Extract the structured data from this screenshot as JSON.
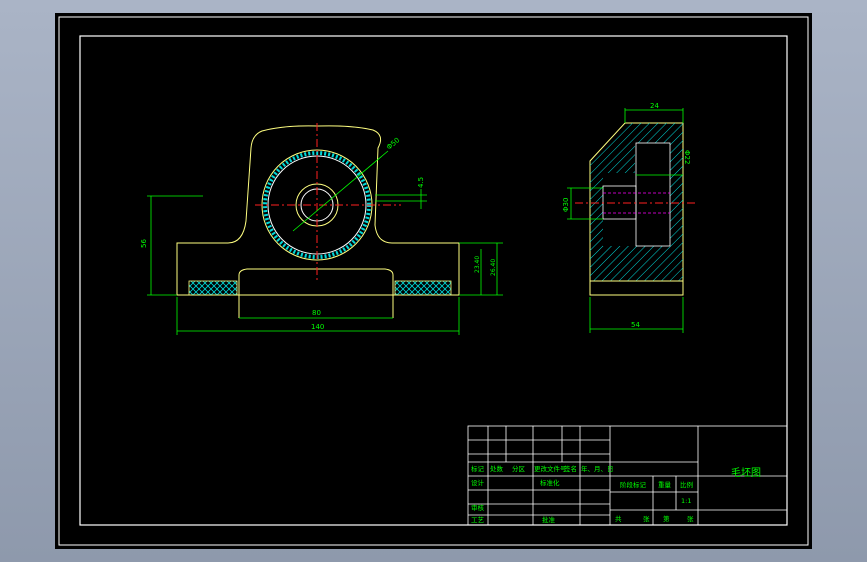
{
  "colors": {
    "background": "#000000",
    "frame": "#ffffff",
    "outline": "#ffff80",
    "dimension": "#00ff00",
    "centerline": "#ff2020",
    "hatch": "#00d8d8",
    "bore": "#ff00ff",
    "text": "#00ff00"
  },
  "front_view": {
    "dim_diameter": "Φ50",
    "dim_offset": "4.5",
    "dim_height": "56",
    "dim_base": "23.40",
    "dim_base_total": "26.40",
    "dim_pad_width": "80",
    "dim_total_width": "140"
  },
  "side_view": {
    "dim_top": "24",
    "dim_bore_outer": "Φ30",
    "dim_bore_inner": "Φ22",
    "dim_bottom": "54"
  },
  "title_block": {
    "drawing_title": "毛坯图",
    "row_header": [
      "标记",
      "处数",
      "分区",
      "更改文件号",
      "签名",
      "年、月、日"
    ],
    "design_label": "设计",
    "standardize_label": "标准化",
    "review_label": "审核",
    "process_label": "工艺",
    "approve_label": "批准",
    "stage_mark_label": "阶段标记",
    "weight_label": "重量",
    "scale_label": "比例",
    "scale_value": "1:1",
    "sheet_total_label": "共",
    "sheet_unit1": "张",
    "sheet_no_label": "第",
    "sheet_unit2": "张"
  }
}
